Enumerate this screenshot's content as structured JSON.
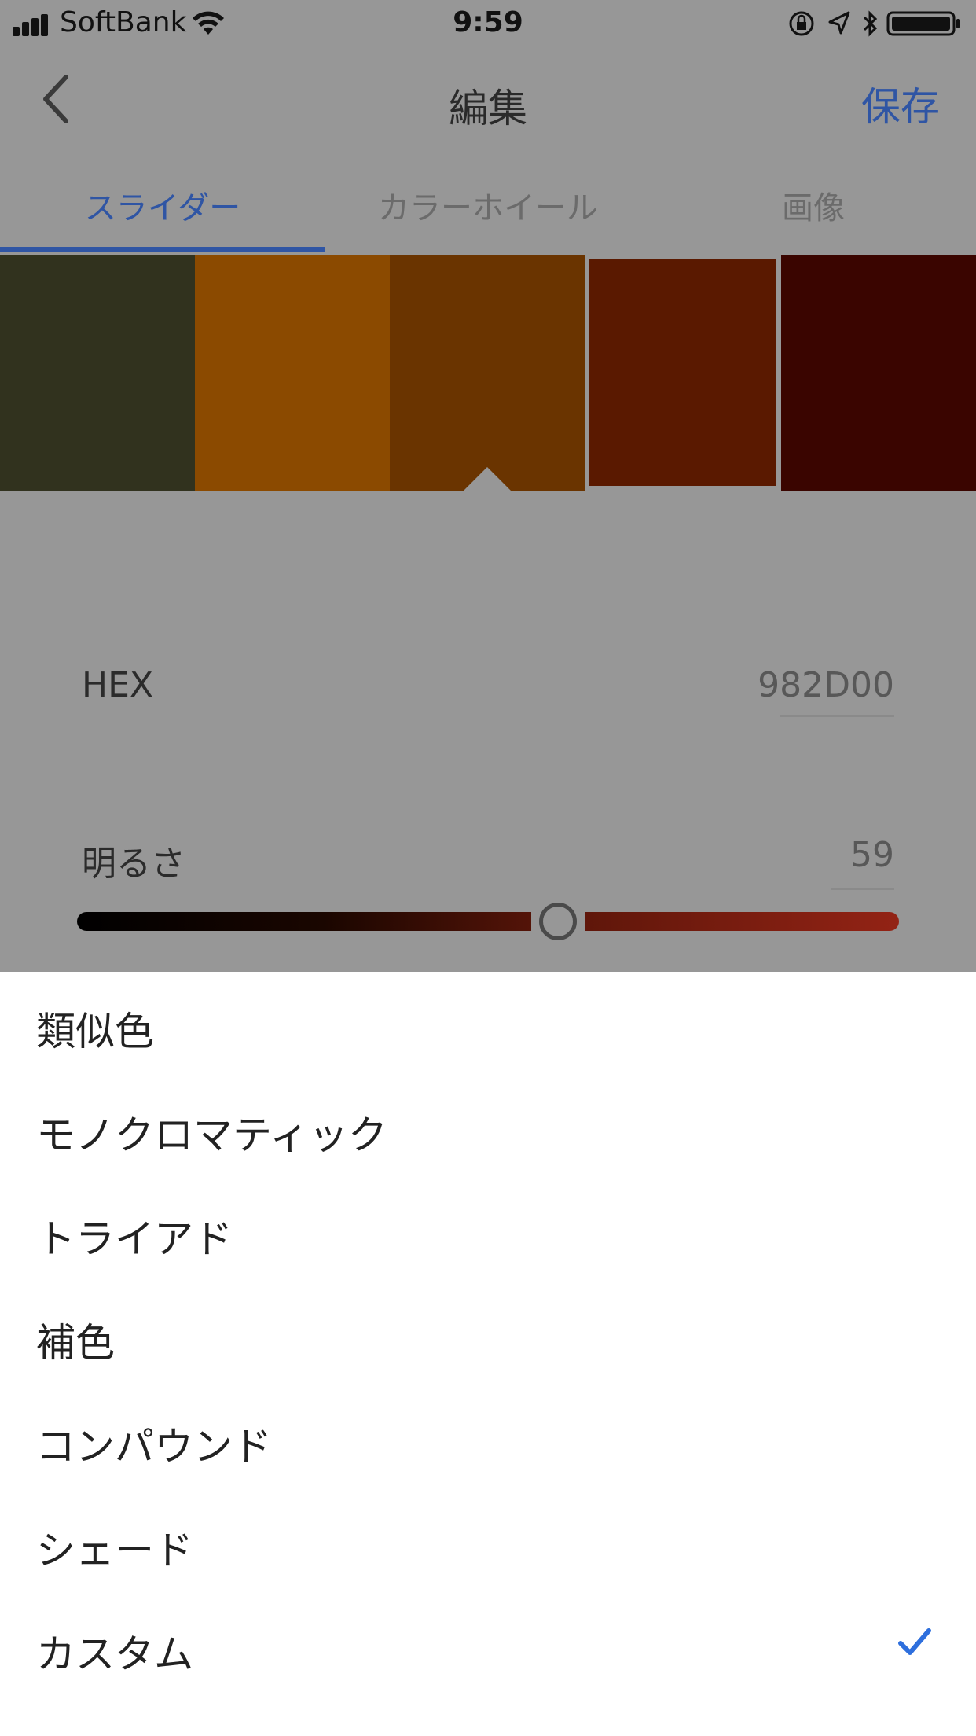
{
  "status": {
    "carrier": "SoftBank",
    "time": "9:59"
  },
  "nav": {
    "title": "編集",
    "save_label": "保存",
    "back_icon": "chevron-left-icon"
  },
  "tabs": [
    {
      "label": "スライダー",
      "active": true
    },
    {
      "label": "カラーホイール",
      "active": false
    },
    {
      "label": "画像",
      "active": false
    }
  ],
  "swatches": [
    "#31321e",
    "#8b4a00",
    "#6a3400",
    "#5a1900",
    "#3a0500"
  ],
  "selected_swatch_index": 2,
  "hex": {
    "label": "HEX",
    "value": "982D00"
  },
  "brightness": {
    "label": "明るさ",
    "value": "59"
  },
  "sheet": {
    "items": [
      {
        "label": "類似色",
        "checked": false
      },
      {
        "label": "モノクロマティック",
        "checked": false
      },
      {
        "label": "トライアド",
        "checked": false
      },
      {
        "label": "補色",
        "checked": false
      },
      {
        "label": "コンパウンド",
        "checked": false
      },
      {
        "label": "シェード",
        "checked": false
      },
      {
        "label": "カスタム",
        "checked": true
      }
    ]
  },
  "colors": {
    "accent": "#2f55a4",
    "check": "#2e6fdd"
  }
}
